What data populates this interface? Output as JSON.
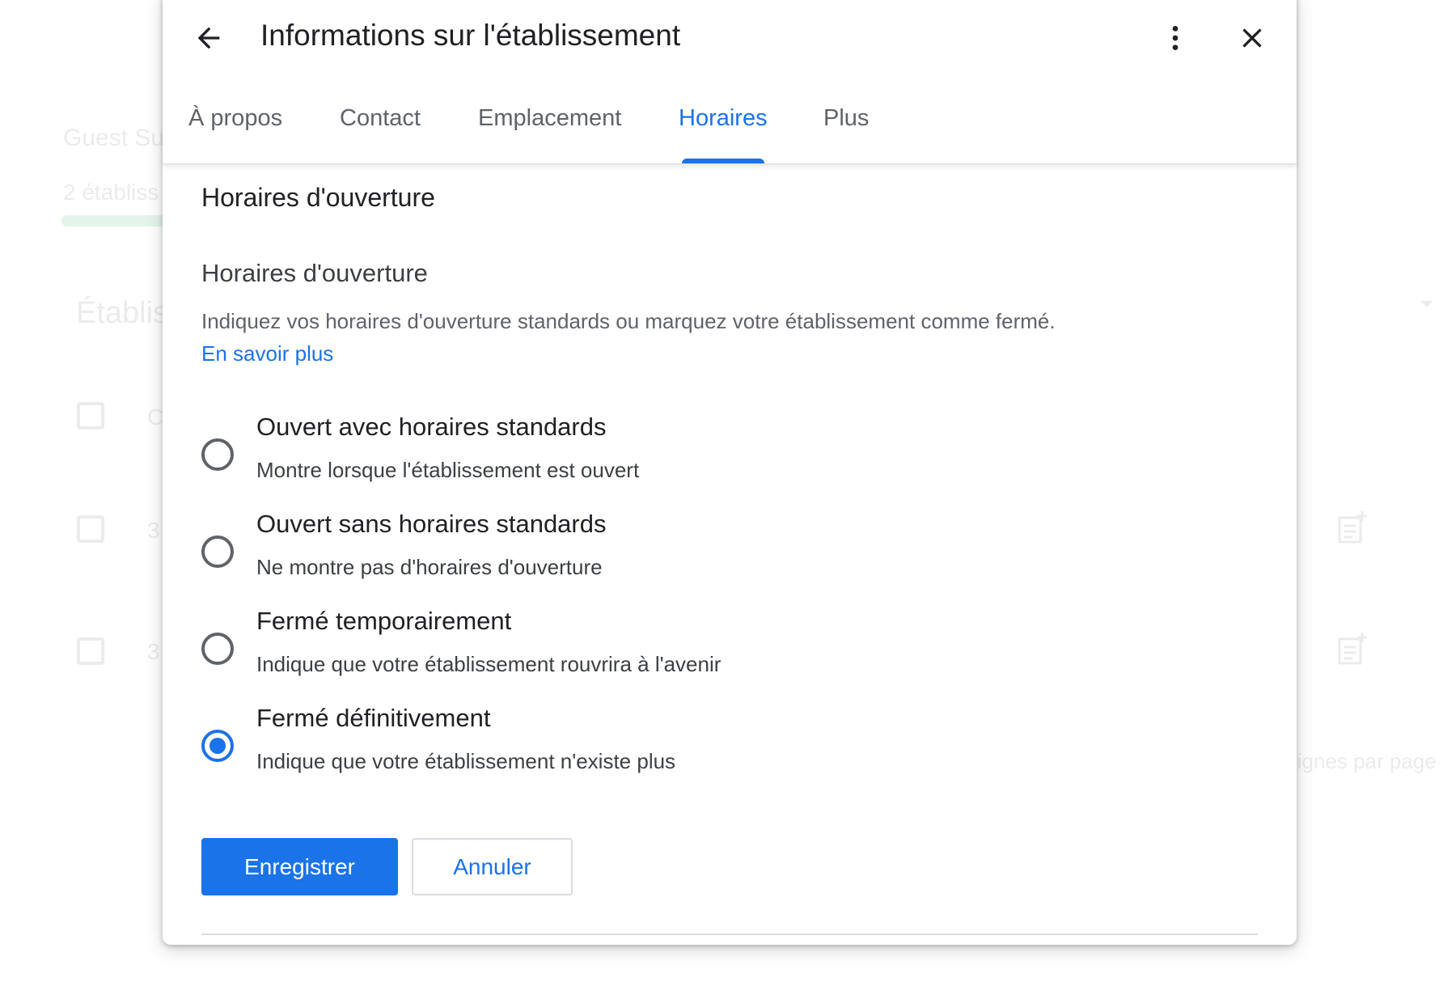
{
  "background": {
    "page_title": "Guest Su",
    "count_text": "2 établiss",
    "section_title": "Établis",
    "row_texts": [
      "C",
      "3",
      "3"
    ],
    "rows_per_page": "lignes par page"
  },
  "dialog": {
    "title": "Informations sur l'établissement",
    "icons": {
      "back": "arrow-back-icon",
      "more": "more-vert-icon",
      "close": "close-icon"
    },
    "tabs": [
      {
        "label": "À propos",
        "active": false
      },
      {
        "label": "Contact",
        "active": false
      },
      {
        "label": "Emplacement",
        "active": false
      },
      {
        "label": "Horaires",
        "active": true
      },
      {
        "label": "Plus",
        "active": false
      }
    ],
    "section_title": "Horaires d'ouverture",
    "subtitle": "Horaires d'ouverture",
    "description": "Indiquez vos horaires d'ouverture standards ou marquez votre établissement comme fermé.",
    "learn_more": "En savoir plus",
    "options": [
      {
        "label": "Ouvert avec horaires standards",
        "sub": "Montre lorsque l'établissement est ouvert",
        "selected": false
      },
      {
        "label": "Ouvert sans horaires standards",
        "sub": "Ne montre pas d'horaires d'ouverture",
        "selected": false
      },
      {
        "label": "Fermé temporairement",
        "sub": "Indique que votre établissement rouvrira à l'avenir",
        "selected": false
      },
      {
        "label": "Fermé définitivement",
        "sub": "Indique que votre établissement n'existe plus",
        "selected": true
      }
    ],
    "save_label": "Enregistrer",
    "cancel_label": "Annuler"
  },
  "colors": {
    "accent": "#1a73e8",
    "text_primary": "#202124",
    "text_secondary": "#5f6368",
    "divider": "#dadce0"
  }
}
